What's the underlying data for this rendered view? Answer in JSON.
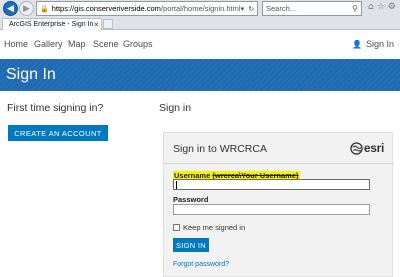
{
  "browser": {
    "url_host": "https://gis.conserveriverside.com",
    "url_path": "/portal/home/signin.html",
    "search_placeholder": "Search...",
    "tab_title": "ArcGIS Enterprise - Sign In",
    "icons": [
      "back-arrow-icon",
      "forward-arrow-icon",
      "lock-icon",
      "search-icon",
      "home-icon",
      "star-icon",
      "gear-icon"
    ]
  },
  "nav": {
    "items": [
      "Home",
      "Gallery",
      "Map",
      "Scene",
      "Groups"
    ],
    "signin_label": "Sign In"
  },
  "banner": {
    "title": "Sign In"
  },
  "left": {
    "heading": "First time signing in?",
    "create_account_label": "CREATE AN ACCOUNT"
  },
  "right": {
    "heading": "Sign in",
    "panel_title": "Sign in to WRCRCA",
    "logo_text": "esri",
    "username_label": "Username",
    "username_hint": "(wrcrca\\Your Username)",
    "password_label": "Password",
    "keep_signed_in_label": "Keep me signed in",
    "signin_button_label": "SIGN IN",
    "forgot_password_label": "Forgot password?"
  },
  "colors": {
    "accent": "#0079c1",
    "banner": "#1e6ab3",
    "highlight": "#f5f20a"
  }
}
